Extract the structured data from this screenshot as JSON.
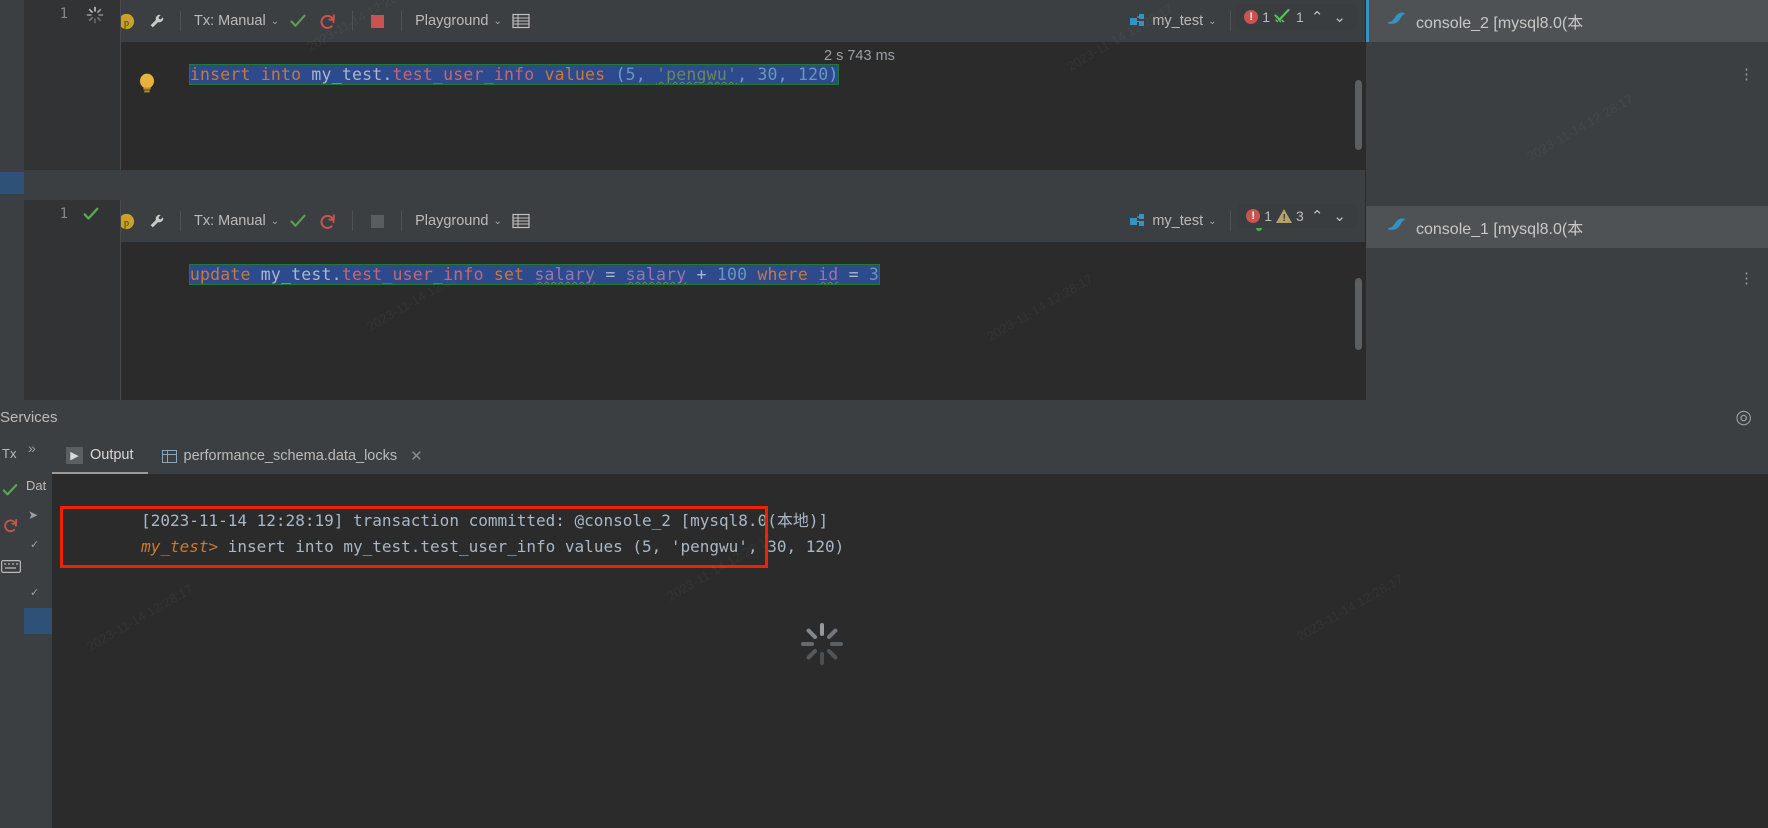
{
  "colors": {
    "accent": "#3592c4",
    "error": "#c75450",
    "warning": "#b5a26b",
    "success": "#5a9e52",
    "selection": "#2d4a8f",
    "redbox": "#ee2200",
    "bg_editor": "#2b2b2b",
    "bg_chrome": "#3c3f41"
  },
  "editors": [
    {
      "toolbar": {
        "run_label": "run-icon",
        "history_label": "history-icon",
        "params_label": "parameters-icon",
        "settings_label": "wrench-icon",
        "tx_mode": "Tx: Manual",
        "commit_label": "commit-icon",
        "rollback_label": "rollback-icon",
        "stop_label": "stop-icon",
        "schema": "Playground",
        "grid_label": "table-view-icon",
        "datasource": "my_test",
        "console": "console_2"
      },
      "tab": {
        "title": "console_2 [mysql8.0(本",
        "icon": "mysql-dolphin-icon"
      },
      "line_number": "1",
      "gutter_mark": "running-spinner-icon",
      "sql": {
        "tokens": [
          {
            "t": "insert into ",
            "c": "kw"
          },
          {
            "t": "my_test.",
            "c": "plain"
          },
          {
            "t": "test_user_info",
            "c": "tbl"
          },
          {
            "t": " values ",
            "c": "kw"
          },
          {
            "t": "(",
            "c": "punc"
          },
          {
            "t": "5",
            "c": "num"
          },
          {
            "t": ", ",
            "c": "punc"
          },
          {
            "t": "'pengwu'",
            "c": "str"
          },
          {
            "t": ", ",
            "c": "punc"
          },
          {
            "t": "30",
            "c": "num"
          },
          {
            "t": ", ",
            "c": "punc"
          },
          {
            "t": "120",
            "c": "num"
          },
          {
            "t": ")",
            "c": "punc"
          }
        ]
      },
      "exec_time": "2 s 743 ms",
      "inspections": {
        "errors": "1",
        "second_icon": "double-check-icon",
        "second_count": "1"
      },
      "bulb": "intention-bulb-icon"
    },
    {
      "toolbar": {
        "run_label": "run-icon",
        "history_label": "history-icon",
        "params_label": "parameters-icon",
        "settings_label": "wrench-icon",
        "tx_mode": "Tx: Manual",
        "commit_label": "commit-icon",
        "rollback_label": "rollback-icon",
        "stop_label": "stop-icon",
        "schema": "Playground",
        "grid_label": "table-view-icon",
        "datasource": "my_test",
        "console": "console_1"
      },
      "tab": {
        "title": "console_1 [mysql8.0(本",
        "icon": "mysql-dolphin-icon"
      },
      "line_number": "1",
      "gutter_mark": "check-icon",
      "sql": {
        "tokens": [
          {
            "t": "update ",
            "c": "kw"
          },
          {
            "t": "my_test.",
            "c": "plain"
          },
          {
            "t": "test_user_info",
            "c": "tbl"
          },
          {
            "t": " set ",
            "c": "kw"
          },
          {
            "t": "salary",
            "c": "col"
          },
          {
            "t": " = ",
            "c": "plain"
          },
          {
            "t": "salary",
            "c": "col"
          },
          {
            "t": " + ",
            "c": "plain"
          },
          {
            "t": "100",
            "c": "num"
          },
          {
            "t": " where ",
            "c": "kw"
          },
          {
            "t": "id",
            "c": "col"
          },
          {
            "t": " = ",
            "c": "plain"
          },
          {
            "t": "3",
            "c": "num"
          }
        ]
      },
      "exec_time": "",
      "inspections": {
        "errors": "1",
        "second_icon": "warning-triangle-icon",
        "second_count": "3"
      },
      "bulb": ""
    }
  ],
  "services": {
    "title": "Services",
    "add_label": "add-service-icon",
    "expand_label": "expand-icon",
    "rail_items": [
      "Tx",
      "Dat"
    ]
  },
  "tool_window": {
    "tabs": [
      {
        "label": "Output",
        "icon": "output-run-icon",
        "active": true,
        "closable": false
      },
      {
        "label": "performance_schema.data_locks",
        "icon": "table-grid-icon",
        "active": false,
        "closable": true
      }
    ],
    "console_lines": [
      {
        "segments": [
          {
            "t": "[2023-11-14 12:28:19] transaction committed: @console_2 [mysql8.0(本地)]",
            "c": "c-grey"
          }
        ]
      },
      {
        "segments": [
          {
            "t": "my_test> ",
            "c": "c-prompt"
          },
          {
            "t": "insert into my_test.test_user_info values (5, 'pengwu', 30, 120)",
            "c": "c-grey"
          }
        ]
      }
    ],
    "highlight_note": "red-box-around-insert-statement",
    "loading": "loading-spinner-icon"
  },
  "watermarks": [
    "2023-11-14 12:28:17",
    "2023-11-14 12:28:17",
    "2023-11-14 12:28:17",
    "2023-11-14 12:28:17",
    "2023-11-14 12:28:17",
    "2023-11-14 12:28:17",
    "2023-11-14 12:28:17",
    "2023-11-14 12:28:17"
  ]
}
